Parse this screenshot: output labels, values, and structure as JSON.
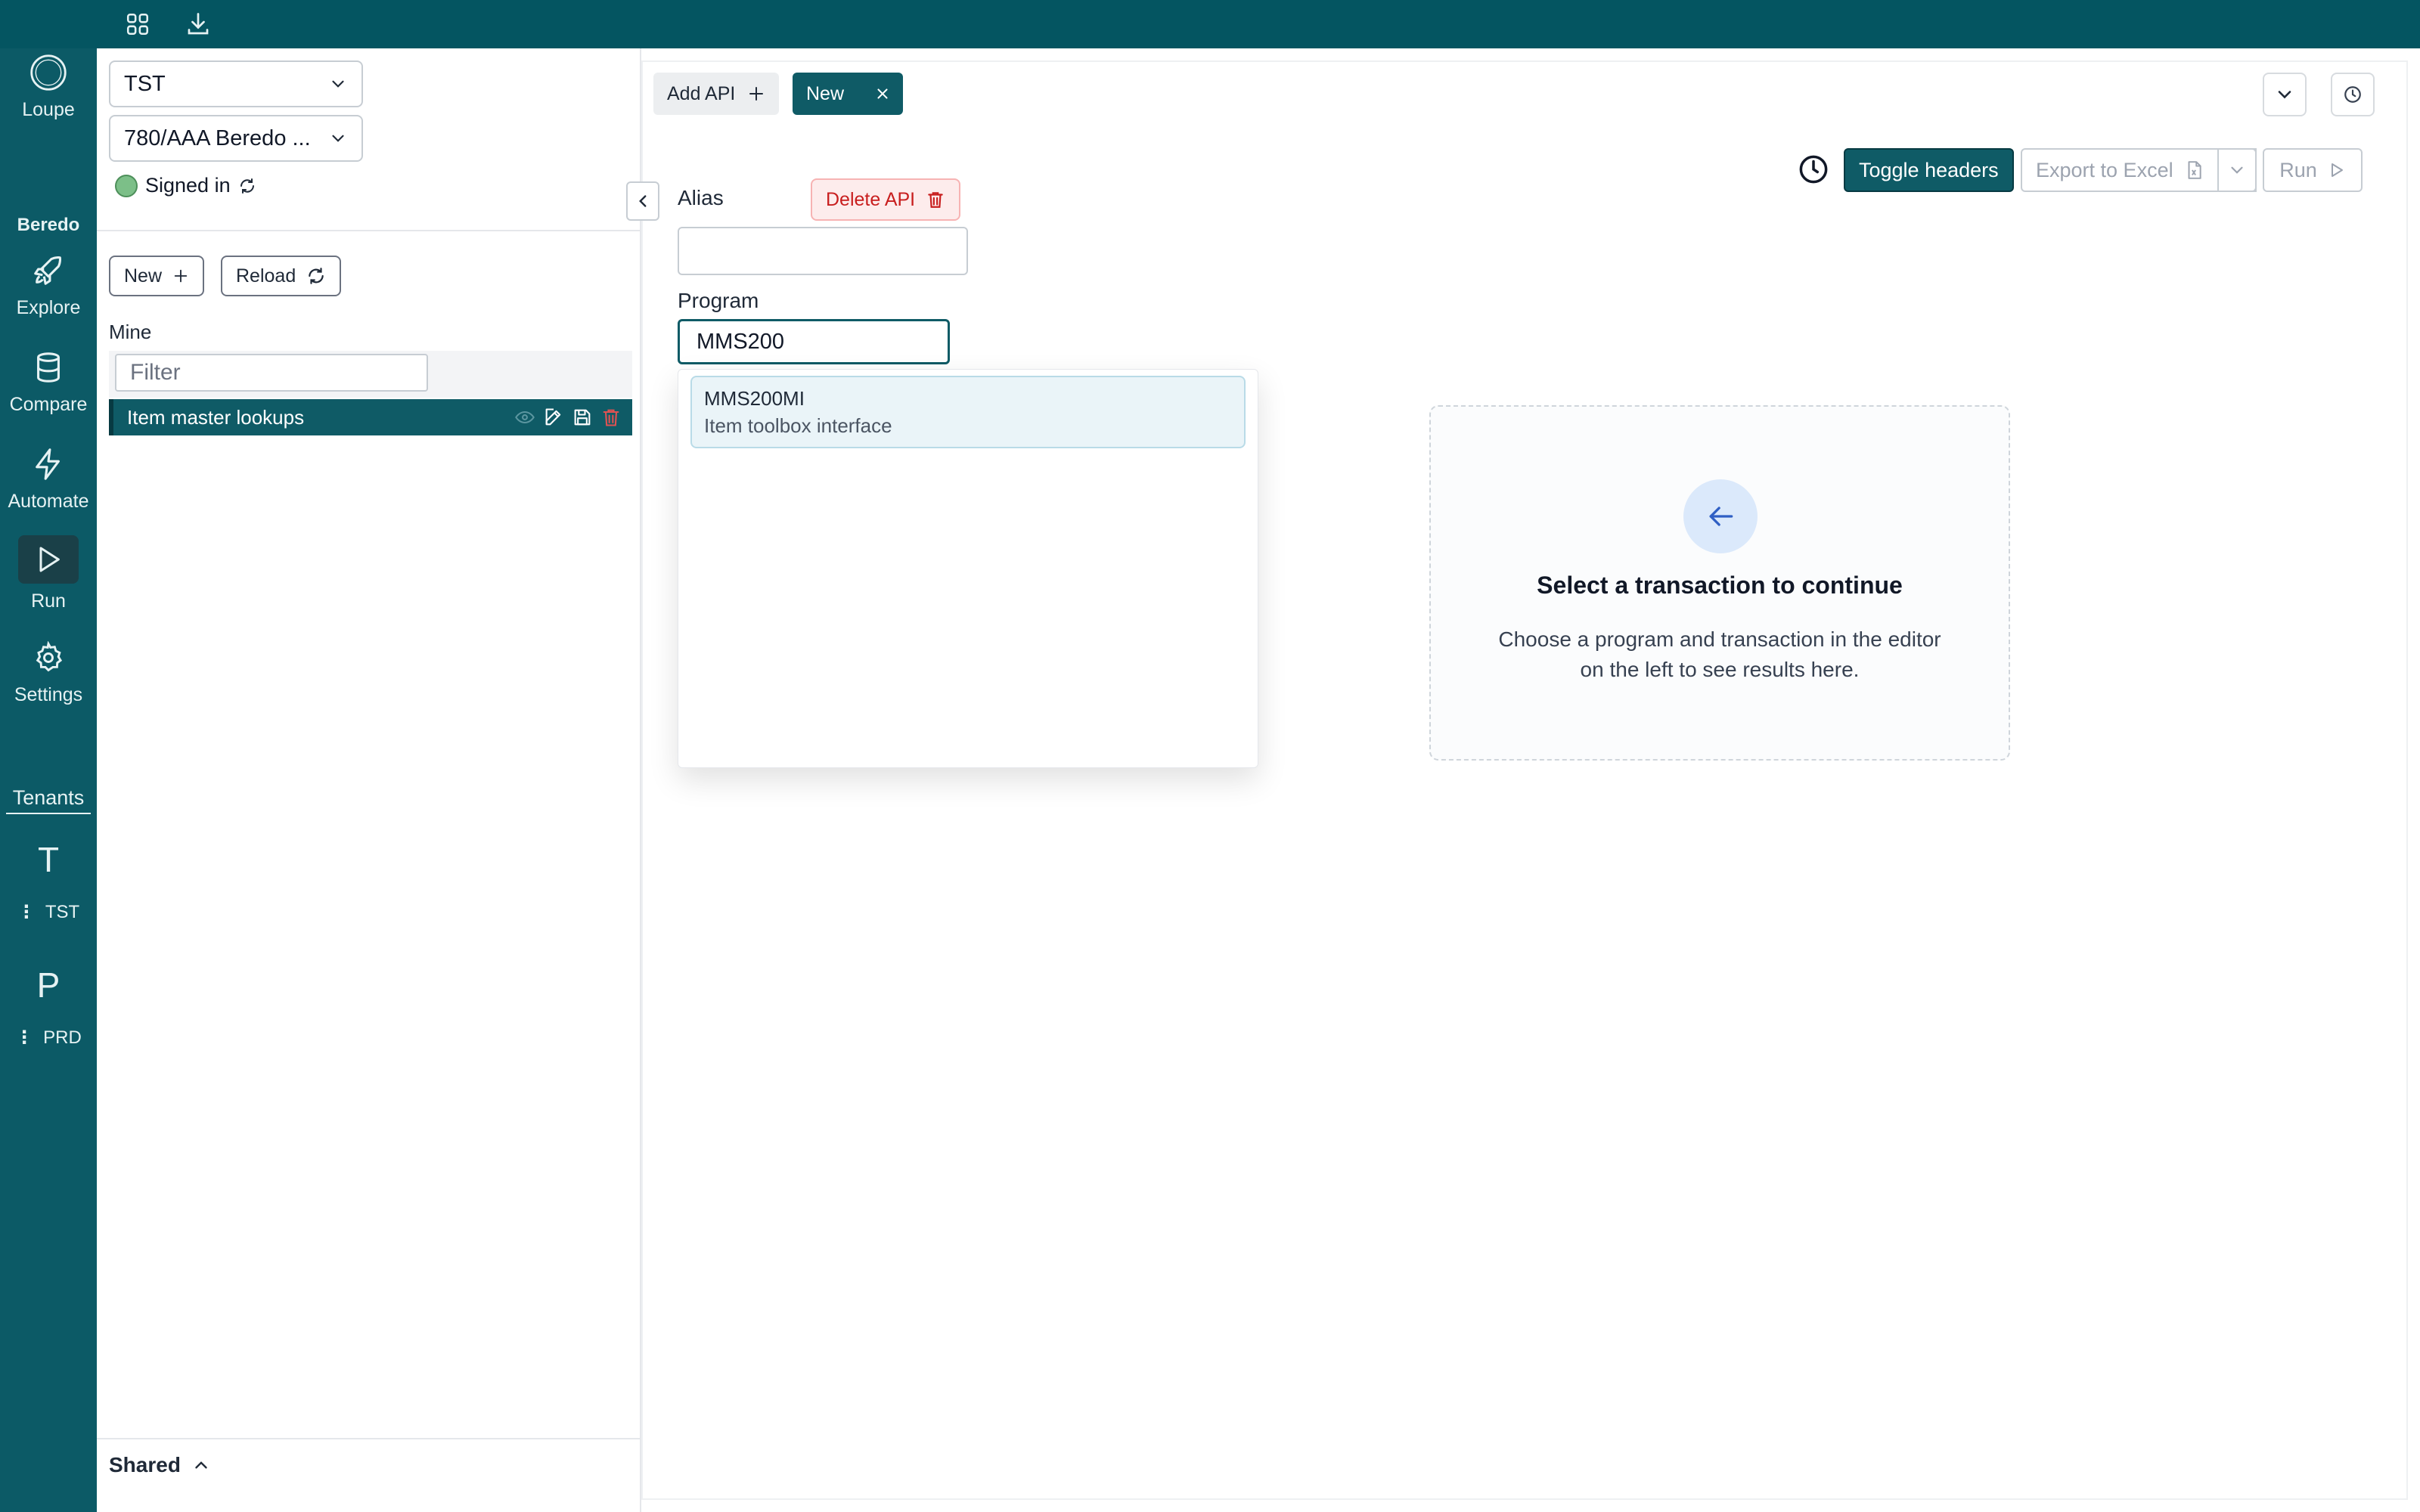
{
  "topbar": {
    "icons": [
      "grid-icon",
      "download-icon"
    ]
  },
  "rail": {
    "brand": {
      "icon": "loupe-circle-icon",
      "label": "Loupe"
    },
    "brand_word": "Beredo",
    "items": [
      {
        "label": "Explore",
        "icon": "rocket-icon"
      },
      {
        "label": "Compare",
        "icon": "database-icon"
      },
      {
        "label": "Automate",
        "icon": "lightning-icon"
      },
      {
        "label": "Run",
        "icon": "play-icon",
        "active": true
      },
      {
        "label": "Settings",
        "icon": "gear-icon"
      }
    ],
    "tenants_label": "Tenants",
    "tenants": [
      {
        "letter": "T",
        "code": "TST"
      },
      {
        "letter": "P",
        "code": "PRD"
      }
    ]
  },
  "left_panel": {
    "environment_select": "TST",
    "company_select": "780/AAA Beredo ...",
    "status": "Signed in",
    "new_button": "New",
    "reload_button": "Reload",
    "mine_label": "Mine",
    "filter_placeholder": "Filter",
    "items": [
      {
        "label": "Item master lookups"
      }
    ],
    "shared_label": "Shared"
  },
  "main": {
    "tabs": [
      {
        "label": "Add API"
      },
      {
        "label": "New",
        "active": true
      }
    ],
    "toolbar": {
      "toggle_headers": "Toggle headers",
      "export_to_excel": "Export to Excel",
      "run": "Run"
    },
    "editor": {
      "alias_label": "Alias",
      "alias_value": "",
      "delete_button": "Delete API",
      "program_label": "Program",
      "program_value": "MMS200",
      "suggestions": [
        {
          "name": "MMS200MI",
          "description": "Item toolbox interface"
        }
      ]
    },
    "empty_state": {
      "title": "Select a transaction to continue",
      "description": "Choose a program and transaction in the editor on the left to see results here."
    }
  },
  "colors": {
    "brand": "#0f5b66",
    "topbar": "#045561",
    "danger": "#c81e1e",
    "status_ok": "#7cbf88"
  }
}
